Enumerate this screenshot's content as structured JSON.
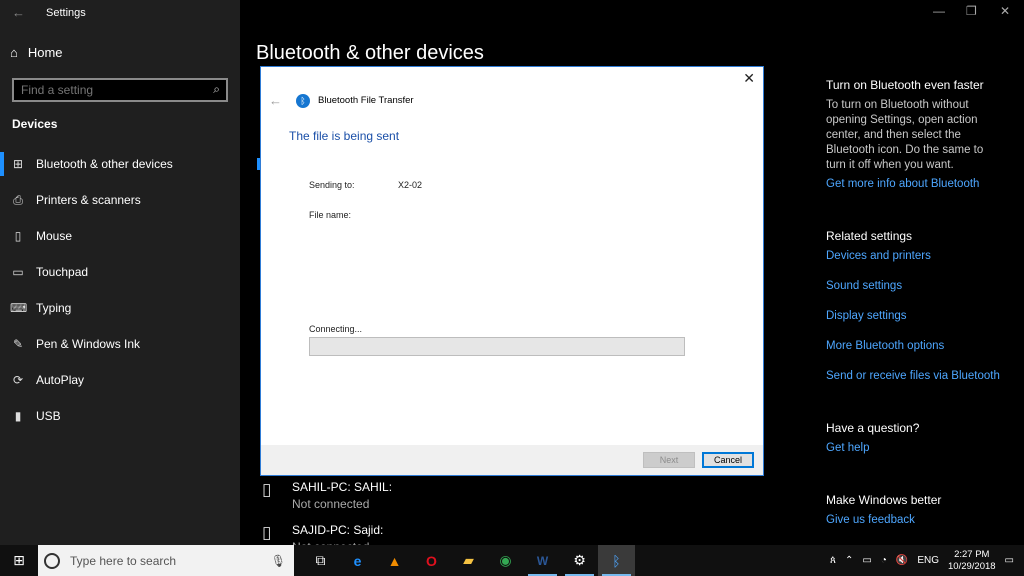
{
  "window": {
    "app_title": "Settings",
    "minimize_glyph": "—",
    "maximize_glyph": "❐",
    "close_glyph": "✕"
  },
  "sidebar": {
    "home_label": "Home",
    "search_placeholder": "Find a setting",
    "section_title": "Devices",
    "items": [
      {
        "label": "Bluetooth & other devices",
        "icon": "bluetooth-devices-icon",
        "glyph": "⊞"
      },
      {
        "label": "Printers & scanners",
        "icon": "printer-icon",
        "glyph": "⎙"
      },
      {
        "label": "Mouse",
        "icon": "mouse-icon",
        "glyph": "▯"
      },
      {
        "label": "Touchpad",
        "icon": "touchpad-icon",
        "glyph": "▭"
      },
      {
        "label": "Typing",
        "icon": "keyboard-icon",
        "glyph": "⌨"
      },
      {
        "label": "Pen & Windows Ink",
        "icon": "pen-icon",
        "glyph": "✎"
      },
      {
        "label": "AutoPlay",
        "icon": "autoplay-icon",
        "glyph": "⟳"
      },
      {
        "label": "USB",
        "icon": "usb-icon",
        "glyph": "▮"
      }
    ]
  },
  "main": {
    "title": "Bluetooth & other devices",
    "devices": [
      {
        "name": "SAHIL-PC: SAHIL:",
        "status": "Not connected",
        "icon": "device-icon"
      },
      {
        "name": "SAJID-PC: Sajid:",
        "status": "Not connected",
        "icon": "device-icon"
      }
    ]
  },
  "right_panel": {
    "faster_title": "Turn on Bluetooth even faster",
    "faster_text": "To turn on Bluetooth without opening Settings, open action center, and then select the Bluetooth icon. Do the same to turn it off when you want.",
    "more_info_link": "Get more info about Bluetooth",
    "related_title": "Related settings",
    "related_links": [
      "Devices and printers",
      "Sound settings",
      "Display settings",
      "More Bluetooth options",
      "Send or receive files via Bluetooth"
    ],
    "question_title": "Have a question?",
    "help_link": "Get help",
    "better_title": "Make Windows better",
    "feedback_link": "Give us feedback"
  },
  "dialog": {
    "title": "Bluetooth File Transfer",
    "heading": "The file is being sent",
    "sending_to_label": "Sending to:",
    "sending_to_value": "X2-02",
    "file_name_label": "File name:",
    "file_name_value": "",
    "status_text": "Connecting...",
    "progress": 0,
    "next_label": "Next",
    "cancel_label": "Cancel",
    "accent_color": "#1a4fa8"
  },
  "taskbar": {
    "search_placeholder": "Type here to search",
    "apps": [
      {
        "icon": "task-view-icon",
        "glyph": "⧉",
        "color": "#ffffff",
        "open": false,
        "active": false
      },
      {
        "icon": "edge-icon",
        "glyph": "e",
        "color": "#1e90ff",
        "open": false,
        "active": false
      },
      {
        "icon": "vlc-icon",
        "glyph": "▲",
        "color": "#f08c00",
        "open": false,
        "active": false
      },
      {
        "icon": "opera-icon",
        "glyph": "O",
        "color": "#e0101e",
        "open": false,
        "active": false
      },
      {
        "icon": "file-explorer-icon",
        "glyph": "▰",
        "color": "#f5c242",
        "open": false,
        "active": false
      },
      {
        "icon": "chrome-icon",
        "glyph": "◉",
        "color": "#34a853",
        "open": false,
        "active": false
      },
      {
        "icon": "word-icon",
        "glyph": "W",
        "color": "#2b5797",
        "open": true,
        "active": false
      },
      {
        "icon": "settings-icon",
        "glyph": "⚙",
        "color": "#ffffff",
        "open": true,
        "active": false
      },
      {
        "icon": "bluetooth-icon",
        "glyph": "ᛒ",
        "color": "#4ea7ff",
        "open": true,
        "active": true
      }
    ],
    "language": "ENG",
    "time": "2:27 PM",
    "date": "10/29/2018"
  }
}
